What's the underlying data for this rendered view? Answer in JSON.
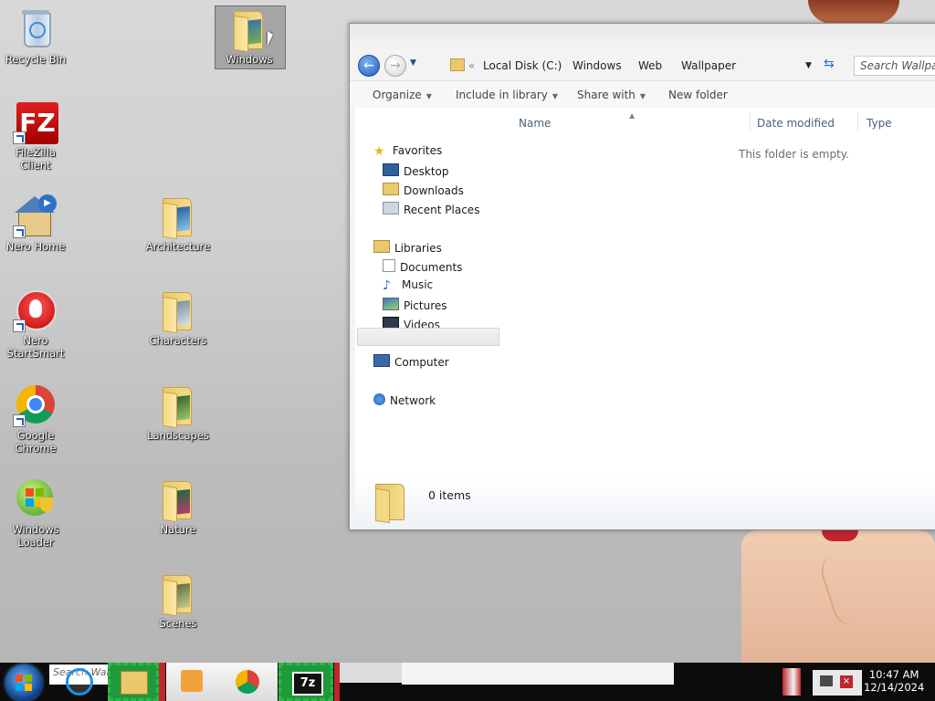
{
  "desktop": {
    "icons": [
      {
        "label": "Recycle Bin"
      },
      {
        "label": "FileZilla Client"
      },
      {
        "label": "Nero Home"
      },
      {
        "label": "Nero StartSmart"
      },
      {
        "label": "Google Chrome"
      },
      {
        "label": "Windows Loader"
      },
      {
        "label": "Windows"
      },
      {
        "label": "Architecture"
      },
      {
        "label": "Characters"
      },
      {
        "label": "Landscapes"
      },
      {
        "label": "Nature"
      },
      {
        "label": "Scenes"
      }
    ]
  },
  "explorer": {
    "breadcrumb": [
      "Local Disk (C:)",
      "Windows",
      "Web",
      "Wallpaper"
    ],
    "search_placeholder": "Search Wallpaper",
    "toolbar": {
      "organize": "Organize",
      "include_in_library": "Include in library",
      "share_with": "Share with",
      "new_folder": "New folder"
    },
    "nav": {
      "favorites": "Favorites",
      "favorites_items": [
        "Desktop",
        "Downloads",
        "Recent Places"
      ],
      "libraries": "Libraries",
      "libraries_items": [
        "Documents",
        "Music",
        "Pictures",
        "Videos"
      ],
      "computer": "Computer",
      "network": "Network"
    },
    "columns": [
      "Name",
      "Date modified",
      "Type"
    ],
    "empty_message": "This folder is empty.",
    "item_count": "0 items"
  },
  "taskbar": {
    "search_text": "Search Wallpaper",
    "time": "10:47 AM",
    "date": "12/14/2024"
  },
  "colors": {
    "accent": "#1f5fb6",
    "taskbar": "#0c0c0c",
    "highlight_green": "#2db84a"
  }
}
